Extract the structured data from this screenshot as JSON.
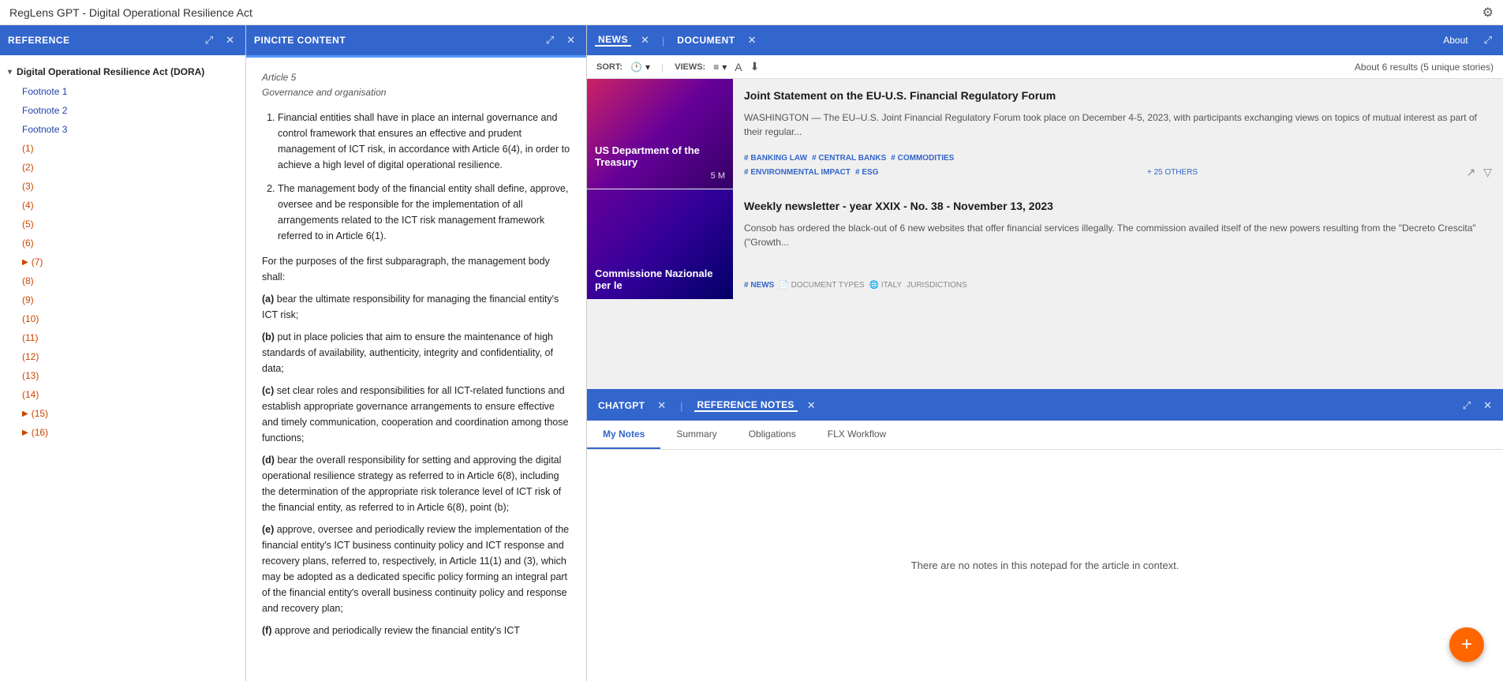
{
  "window": {
    "title": "RegLens GPT - Digital Operational Resilience Act"
  },
  "reference_panel": {
    "title": "REFERENCE",
    "group": {
      "label": "Digital Operational Resilience Act (DORA)",
      "items": [
        {
          "label": "Footnote 1",
          "type": "footnote"
        },
        {
          "label": "Footnote 2",
          "type": "footnote"
        },
        {
          "label": "Footnote 3",
          "type": "footnote"
        },
        {
          "label": "(1)",
          "type": "numbered"
        },
        {
          "label": "(2)",
          "type": "numbered"
        },
        {
          "label": "(3)",
          "type": "numbered"
        },
        {
          "label": "(4)",
          "type": "numbered"
        },
        {
          "label": "(5)",
          "type": "numbered"
        },
        {
          "label": "(6)",
          "type": "numbered"
        },
        {
          "label": "(7)",
          "type": "numbered",
          "has_children": true
        },
        {
          "label": "(8)",
          "type": "numbered"
        },
        {
          "label": "(9)",
          "type": "numbered"
        },
        {
          "label": "(10)",
          "type": "numbered"
        },
        {
          "label": "(11)",
          "type": "numbered"
        },
        {
          "label": "(12)",
          "type": "numbered"
        },
        {
          "label": "(13)",
          "type": "numbered"
        },
        {
          "label": "(14)",
          "type": "numbered"
        },
        {
          "label": "(15)",
          "type": "numbered",
          "has_children": true
        },
        {
          "label": "(16)",
          "type": "numbered",
          "has_children": true
        }
      ]
    }
  },
  "pincite_panel": {
    "title": "PINCITE CONTENT",
    "article": "Article 5",
    "article_subtitle": "Governance and organisation",
    "paragraphs": [
      {
        "index": 1,
        "text": "Financial entities shall have in place an internal governance and control framework that ensures an effective and prudent management of ICT risk, in accordance with Article 6(4), in order to achieve a high level of digital operational resilience."
      },
      {
        "index": 2,
        "text": "The management body of the financial entity shall define, approve, oversee and be responsible for the implementation of all arrangements related to the ICT risk management framework referred to in Article 6(1)."
      }
    ],
    "subparagraph_intro": "For the purposes of the first subparagraph, the management body shall:",
    "subparagraphs": [
      {
        "label": "(a)",
        "text": "bear the ultimate responsibility for managing the financial entity's ICT risk;"
      },
      {
        "label": "(b)",
        "text": "put in place policies that aim to ensure the maintenance of high standards of availability, authenticity, integrity and confidentiality, of data;"
      },
      {
        "label": "(c)",
        "text": "set clear roles and responsibilities for all ICT-related functions and establish appropriate governance arrangements to ensure effective and timely communication, cooperation and coordination among those functions;"
      },
      {
        "label": "(d)",
        "text": "bear the overall responsibility for setting and approving the digital operational resilience strategy as referred to in Article 6(8), including the determination of the appropriate risk tolerance level of ICT risk of the financial entity, as referred to in Article 6(8), point (b);"
      },
      {
        "label": "(e)",
        "text": "approve, oversee and periodically review the implementation of the financial entity's ICT business continuity policy and ICT response and recovery plans, referred to, respectively, in Article 11(1) and (3), which may be adopted as a dedicated specific policy forming an integral part of the financial entity's overall business continuity policy and response and recovery plan;"
      },
      {
        "label": "(f)",
        "text": "approve and periodically review the financial entity's ICT"
      }
    ]
  },
  "news_panel": {
    "tabs": [
      {
        "label": "NEWS",
        "active": true
      },
      {
        "label": "DOCUMENT",
        "active": false
      }
    ],
    "sort_label": "SORT:",
    "views_label": "VIEWS:",
    "result_count": "About 6 results (5 unique stories)",
    "about_label": "About",
    "items": [
      {
        "id": 1,
        "thumbnail_label": "US Department of the Treasury",
        "thumbnail_date": "5 M",
        "thumbnail_class": "thumb-treasury",
        "title": "Joint Statement on the EU-U.S. Financial Regulatory Forum",
        "summary": "WASHINGTON — The EU–U.S. Joint Financial Regulatory Forum took place on December 4-5, 2023, with participants exchanging views on topics of mutual interest as part of their regular...",
        "tags": [
          "BANKING LAW",
          "CENTRAL BANKS",
          "COMMODITIES",
          "ENVIRONMENTAL IMPACT",
          "ESG"
        ],
        "extra_tags": "+ 25 OTHERS"
      },
      {
        "id": 2,
        "thumbnail_label": "Commissione Nazionale per le",
        "thumbnail_class": "thumb-commissione",
        "title": "Weekly newsletter - year XXIX - No. 38 - November 13, 2023",
        "summary": "Consob has ordered the black-out of 6 new websites that offer financial services illegally. The commission availed itself of the new powers resulting from the \"Decreto Crescita\" (\"Growth...",
        "tags_row1": [
          "NEWS"
        ],
        "tags_row2": [
          "DOCUMENT TYPES",
          "ITALY",
          "JURISDICTIONS"
        ]
      }
    ]
  },
  "bottom_panel": {
    "tabs": [
      {
        "label": "CHATGPT",
        "active": false
      },
      {
        "label": "REFERENCE NOTES",
        "active": true
      }
    ],
    "notes_tabs": [
      {
        "label": "My Notes",
        "active": true
      },
      {
        "label": "Summary",
        "active": false
      },
      {
        "label": "Obligations",
        "active": false
      },
      {
        "label": "FLX Workflow",
        "active": false
      }
    ],
    "empty_message": "There are no notes in this notepad for the article in context."
  },
  "fab": {
    "label": "+"
  }
}
